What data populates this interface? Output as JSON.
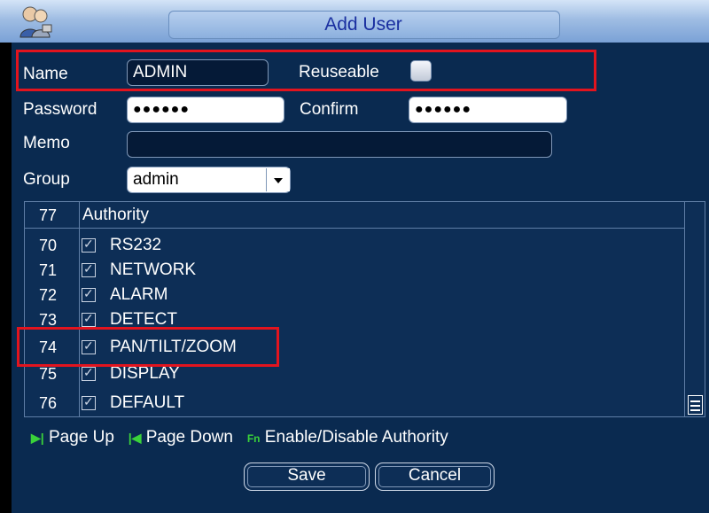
{
  "dialog": {
    "title": "Add User",
    "icon": "users-icon"
  },
  "form": {
    "name_label": "Name",
    "name_value": "ADMIN",
    "reuseable_label": "Reuseable",
    "reuseable_checked": false,
    "password_label": "Password",
    "password_value": "●●●●●●",
    "confirm_label": "Confirm",
    "confirm_value": "●●●●●●",
    "memo_label": "Memo",
    "memo_value": "",
    "group_label": "Group",
    "group_value": "admin"
  },
  "authority": {
    "header_num": "77",
    "header_label": "Authority",
    "rows": [
      {
        "num": "70",
        "label": "RS232",
        "checked": true
      },
      {
        "num": "71",
        "label": "NETWORK",
        "checked": true
      },
      {
        "num": "72",
        "label": "ALARM",
        "checked": true
      },
      {
        "num": "73",
        "label": "DETECT",
        "checked": true
      },
      {
        "num": "74",
        "label": "PAN/TILT/ZOOM",
        "checked": true
      },
      {
        "num": "75",
        "label": "DISPLAY",
        "checked": true
      },
      {
        "num": "76",
        "label": "DEFAULT",
        "checked": true
      }
    ]
  },
  "hints": {
    "page_up_icon": "▶|",
    "page_up_label": "Page Up",
    "page_down_icon": "|◀",
    "page_down_label": "Page Down",
    "fn_icon": "Fn",
    "fn_label": "Enable/Disable Authority"
  },
  "buttons": {
    "save_label": "Save",
    "cancel_label": "Cancel"
  },
  "colors": {
    "highlight": "#e2141e",
    "panel": "#0a2a50",
    "title_text": "#1a2fa0"
  }
}
